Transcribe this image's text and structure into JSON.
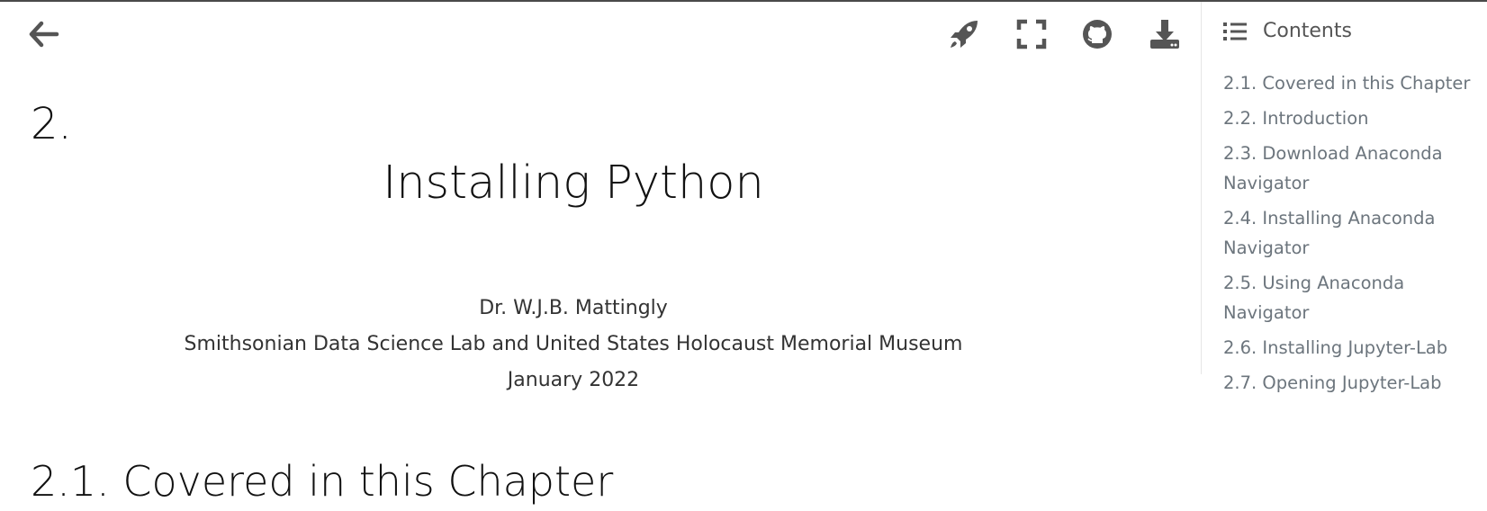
{
  "toolbar": {
    "back": "arrow-left-icon",
    "launch": "rocket-icon",
    "fullscreen": "fullscreen-icon",
    "github": "github-icon",
    "download": "download-icon"
  },
  "main": {
    "chapter_number": "2.",
    "title": "Installing Python",
    "author": "Dr. W.J.B. Mattingly",
    "affiliation": "Smithsonian Data Science Lab and United States Holocaust Memorial Museum",
    "date": "January 2022",
    "section_heading": "2.1. Covered in this Chapter"
  },
  "toc": {
    "label": "Contents",
    "items": [
      "2.1. Covered in this Chapter",
      "2.2. Introduction",
      "2.3. Download Anaconda Navigator",
      "2.4. Installing Anaconda Navigator",
      "2.5. Using Anaconda Navigator",
      "2.6. Installing Jupyter-Lab",
      "2.7. Opening Jupyter-Lab"
    ]
  },
  "colors": {
    "icon": "#555555",
    "text": "#111111",
    "toc_text": "#6c757d"
  }
}
